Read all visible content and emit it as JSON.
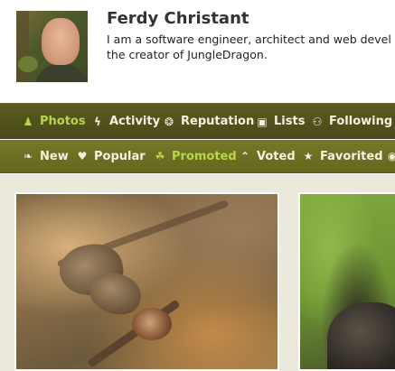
{
  "profile": {
    "name": "Ferdy Christant",
    "bio_line1": "I am a software engineer, architect and web devel",
    "bio_line2": "the creator of JungleDragon."
  },
  "main_nav": [
    {
      "label": "Photos",
      "icon": "user-icon",
      "glyph": "♟",
      "active": true
    },
    {
      "label": "Activity",
      "icon": "bolt-icon",
      "glyph": "ϟ",
      "active": false
    },
    {
      "label": "Reputation",
      "icon": "trophy-icon",
      "glyph": "❂",
      "active": false
    },
    {
      "label": "Lists",
      "icon": "camera-icon",
      "glyph": "▣",
      "active": false
    },
    {
      "label": "Following",
      "icon": "group-icon",
      "glyph": "⚇",
      "active": false
    }
  ],
  "sub_nav": [
    {
      "label": "New",
      "icon": "leaf-icon",
      "glyph": "❧",
      "active": false
    },
    {
      "label": "Popular",
      "icon": "heart-icon",
      "glyph": "♥",
      "active": false
    },
    {
      "label": "Promoted",
      "icon": "bird-icon",
      "glyph": "☘",
      "active": true
    },
    {
      "label": "Voted",
      "icon": "chevron-up-icon",
      "glyph": "⌃",
      "active": false
    },
    {
      "label": "Favorited",
      "icon": "star-icon",
      "glyph": "★",
      "active": false
    },
    {
      "label": "",
      "icon": "map-marker-icon",
      "glyph": "◉",
      "active": false
    }
  ],
  "photos": [
    {
      "subject": "butterfly-on-acorn"
    },
    {
      "subject": "furry-animal"
    }
  ],
  "colors": {
    "nav_text": "#f4f1e0",
    "nav_active": "#b9d548",
    "nav_bg_top": "#4e4e1b",
    "nav_bg_sub": "#6d6f23",
    "content_bg": "#ebe9dc"
  }
}
